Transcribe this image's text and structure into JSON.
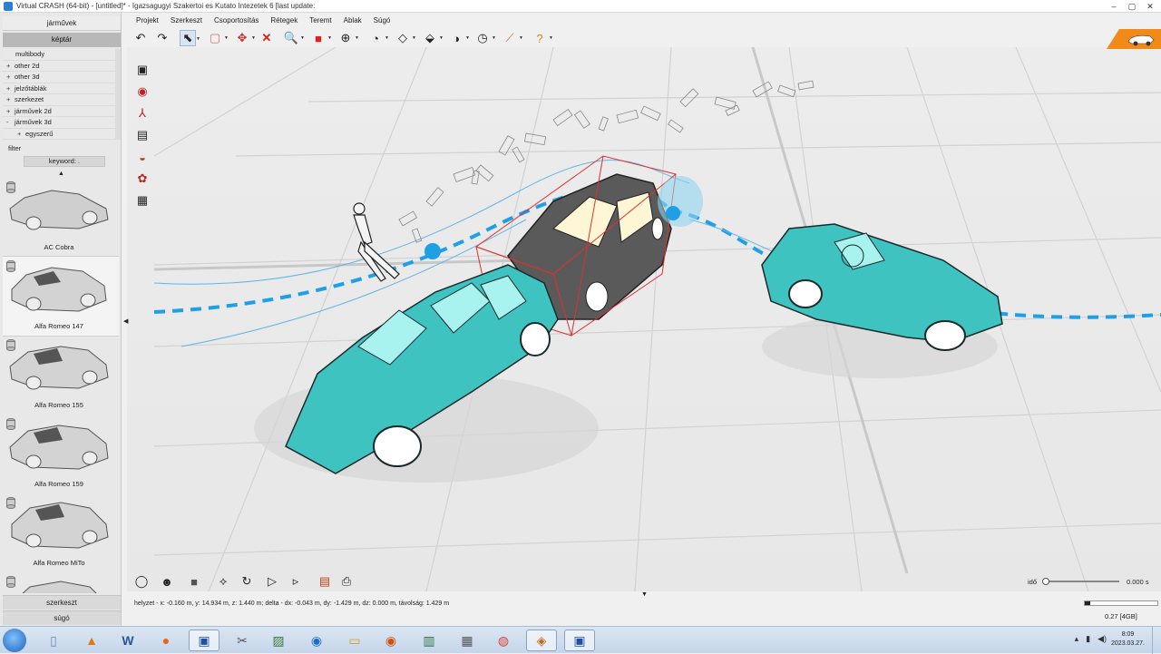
{
  "window": {
    "title": "Virtual CRASH (64-bit) - [untitled]* - Igazsagugyi Szakertoi es Kutato Intezetek 6 [last update:",
    "controls": [
      "–",
      "▢",
      "✕"
    ]
  },
  "menu": [
    "Projekt",
    "Szerkeszt",
    "Csoportosítás",
    "Rétegek",
    "Teremt",
    "Ablak",
    "Súgó"
  ],
  "left_panel": {
    "tabs": [
      "járművek",
      "képtár"
    ],
    "tree": [
      {
        "label": "multibody",
        "marker": ""
      },
      {
        "label": "other 2d",
        "marker": "+"
      },
      {
        "label": "other 3d",
        "marker": "+"
      },
      {
        "label": "jelzőtáblák",
        "marker": "+"
      },
      {
        "label": "szerkezet",
        "marker": "+"
      },
      {
        "label": "járművek 2d",
        "marker": "+"
      },
      {
        "label": "járművek 3d",
        "marker": "-"
      },
      {
        "label": "egyszerű",
        "marker": "+"
      }
    ],
    "filter_label": "filter",
    "keyword_label": "keyword: .",
    "gallery": [
      "AC Cobra",
      "Alfa Romeo 147",
      "Alfa Romeo 155",
      "Alfa Romeo 159",
      "Alfa Romeo MiTo"
    ],
    "bottom_tabs": [
      "szerkeszt",
      "súgó"
    ]
  },
  "timeline": {
    "label": "idő",
    "value": "0.000 s",
    "progress": 0.0
  },
  "status_text": "helyzet - x: -0.160 m, y: 14.934 m, z: 1.440 m; delta - dx: -0.043 m, dy: -1.429 m, dz: 0.000 m, távolság: 1.429 m",
  "memory": {
    "label": "0.27 [4GB]",
    "fraction": 0.07
  },
  "clock": {
    "time": "8:09",
    "date": "2023.03.27."
  },
  "colors": {
    "vehicle": "#3fc3c0",
    "path": "#1e9fe6",
    "bbox": "#e03030",
    "brand": "#f28a1a"
  }
}
